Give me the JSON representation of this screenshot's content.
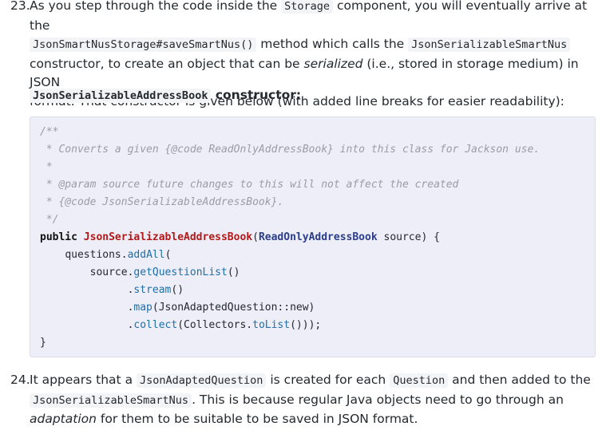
{
  "item23": {
    "number": "23.",
    "line1": {
      "t1": "As you step through the code inside the ",
      "c1": "Storage",
      "t2": " component, you will eventually arrive at the"
    },
    "line2": {
      "c1": "JsonSmartNusStorage#saveSmartNus()",
      "t1": " method which calls the ",
      "c2": "JsonSerializableSmartNus"
    },
    "line3": {
      "t1": "constructor, to create an object that can be ",
      "em": "serialized",
      "t2": " (i.e., stored in storage medium) in JSON"
    },
    "line4": "format. That constructor is given below (with added line breaks for easier readability):"
  },
  "heading": {
    "code": "JsonSerializableAddressBook",
    "text": " constructor:"
  },
  "code_block": {
    "comment": [
      "/**",
      " * Converts a given {@code ReadOnlyAddressBook} into this class for Jackson use.",
      " *",
      " * @param source future changes to this will not affect the created",
      " * {@code JsonSerializableAddressBook}.",
      " */"
    ],
    "sig": {
      "kw": "public ",
      "name": "JsonSerializableAddressBook",
      "open": "(",
      "type": "ReadOnlyAddressBook",
      "rest": " source) {"
    },
    "l_add": {
      "indent": "    ",
      "obj": "questions.",
      "fn": "addAll",
      "rest": "("
    },
    "l_get": {
      "indent": "        ",
      "obj": "source.",
      "fn": "getQuestionList",
      "rest": "()"
    },
    "l_stream": {
      "indent": "              ",
      "dot": ".",
      "fn": "stream",
      "rest": "()"
    },
    "l_map": {
      "indent": "              ",
      "dot": ".",
      "fn": "map",
      "rest": "(JsonAdaptedQuestion::new)"
    },
    "l_collect": {
      "indent": "              ",
      "dot": ".",
      "fn": "collect",
      "mid": "(Collectors.",
      "fn2": "toList",
      "rest": "()));"
    },
    "close": "}"
  },
  "item24": {
    "number": "24.",
    "line1": {
      "t1": "It appears that a ",
      "c1": "JsonAdaptedQuestion",
      "t2": " is created for each ",
      "c2": "Question",
      "t3": " and then added to the"
    },
    "line2": {
      "c1": "JsonSerializableSmartNus",
      "t1": ". This is because regular Java objects need to go through an"
    },
    "line3": {
      "em": "adaptation",
      "t1": " for them to be suitable to be saved in JSON format."
    }
  }
}
